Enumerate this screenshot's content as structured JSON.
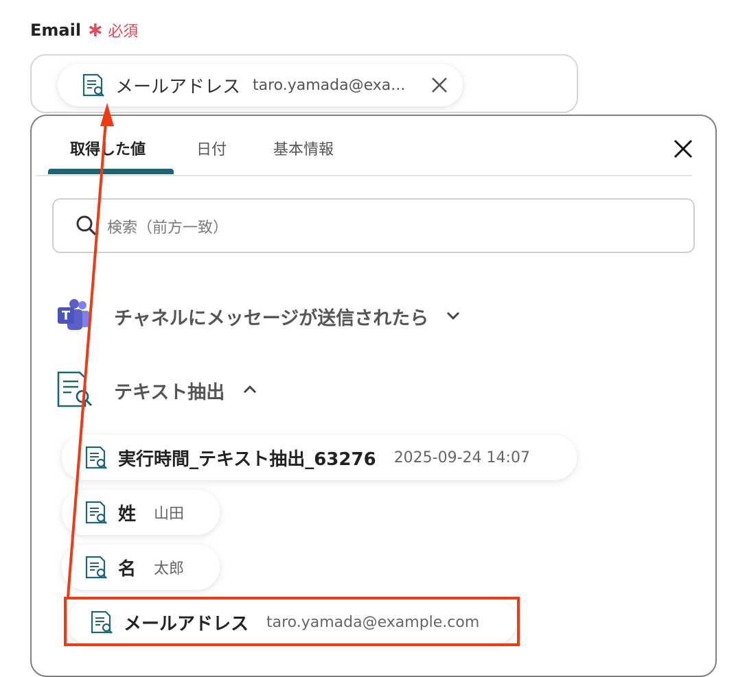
{
  "field": {
    "label": "Email",
    "required_mark": "∗",
    "required_text": "必須"
  },
  "selected_chip": {
    "label": "メールアドレス",
    "value": "taro.yamada@exa..."
  },
  "tabs": [
    {
      "label": "取得した値",
      "active": true
    },
    {
      "label": "日付",
      "active": false
    },
    {
      "label": "基本情報",
      "active": false
    }
  ],
  "search": {
    "placeholder": "検索（前方一致）"
  },
  "sections": [
    {
      "title": "チャネルにメッセージが送信されたら",
      "expanded": false,
      "icon": "teams-icon"
    },
    {
      "title": "テキスト抽出",
      "expanded": true,
      "icon": "text-extract-icon"
    }
  ],
  "items": [
    {
      "label": "実行時間_テキスト抽出_63276",
      "value": "2025-09-24 14:07"
    },
    {
      "label": "姓",
      "value": "山田"
    },
    {
      "label": "名",
      "value": "太郎"
    },
    {
      "label": "メールアドレス",
      "value": "taro.yamada@example.com"
    }
  ],
  "colors": {
    "accent": "#1a6673",
    "required": "#e8475a",
    "annotation": "#f03a14",
    "teams": "#5b5fc7"
  }
}
